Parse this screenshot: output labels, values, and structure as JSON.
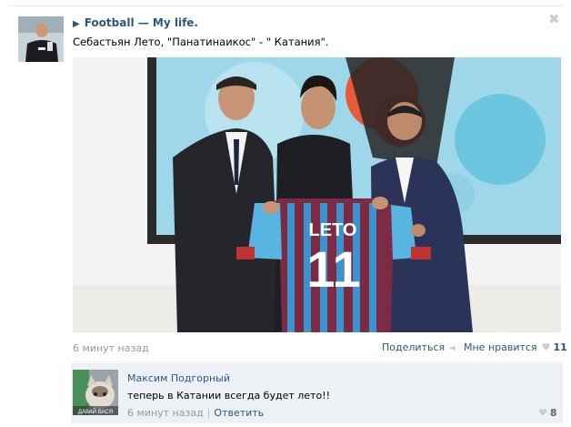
{
  "post": {
    "author": "Football — My life.",
    "text": "Себастьян Лето, \"Панатинаикос\" - \" Катания\".",
    "time": "6 минут назад",
    "share_label": "Поделиться",
    "like_label": "Мне нравится",
    "like_count": "11",
    "photo": {
      "jersey_name": "LETO",
      "jersey_number": "11"
    }
  },
  "comment": {
    "author": "Максим Подгорный",
    "text": "теперь в Катании всегда будет лето!!",
    "time": "6 минут назад",
    "reply_label": "Ответить",
    "like_count": "8",
    "avatar_caption": "ДАВАЙ ВАСЯ"
  },
  "icons": {
    "close": "close-icon",
    "author_arrow": "triangle-right-icon",
    "share": "megaphone-icon",
    "like": "heart-icon"
  },
  "colors": {
    "link": "#2b587a",
    "muted": "#999999",
    "comment_bg": "#edf1f5",
    "icon_grey": "#c5ced8"
  }
}
